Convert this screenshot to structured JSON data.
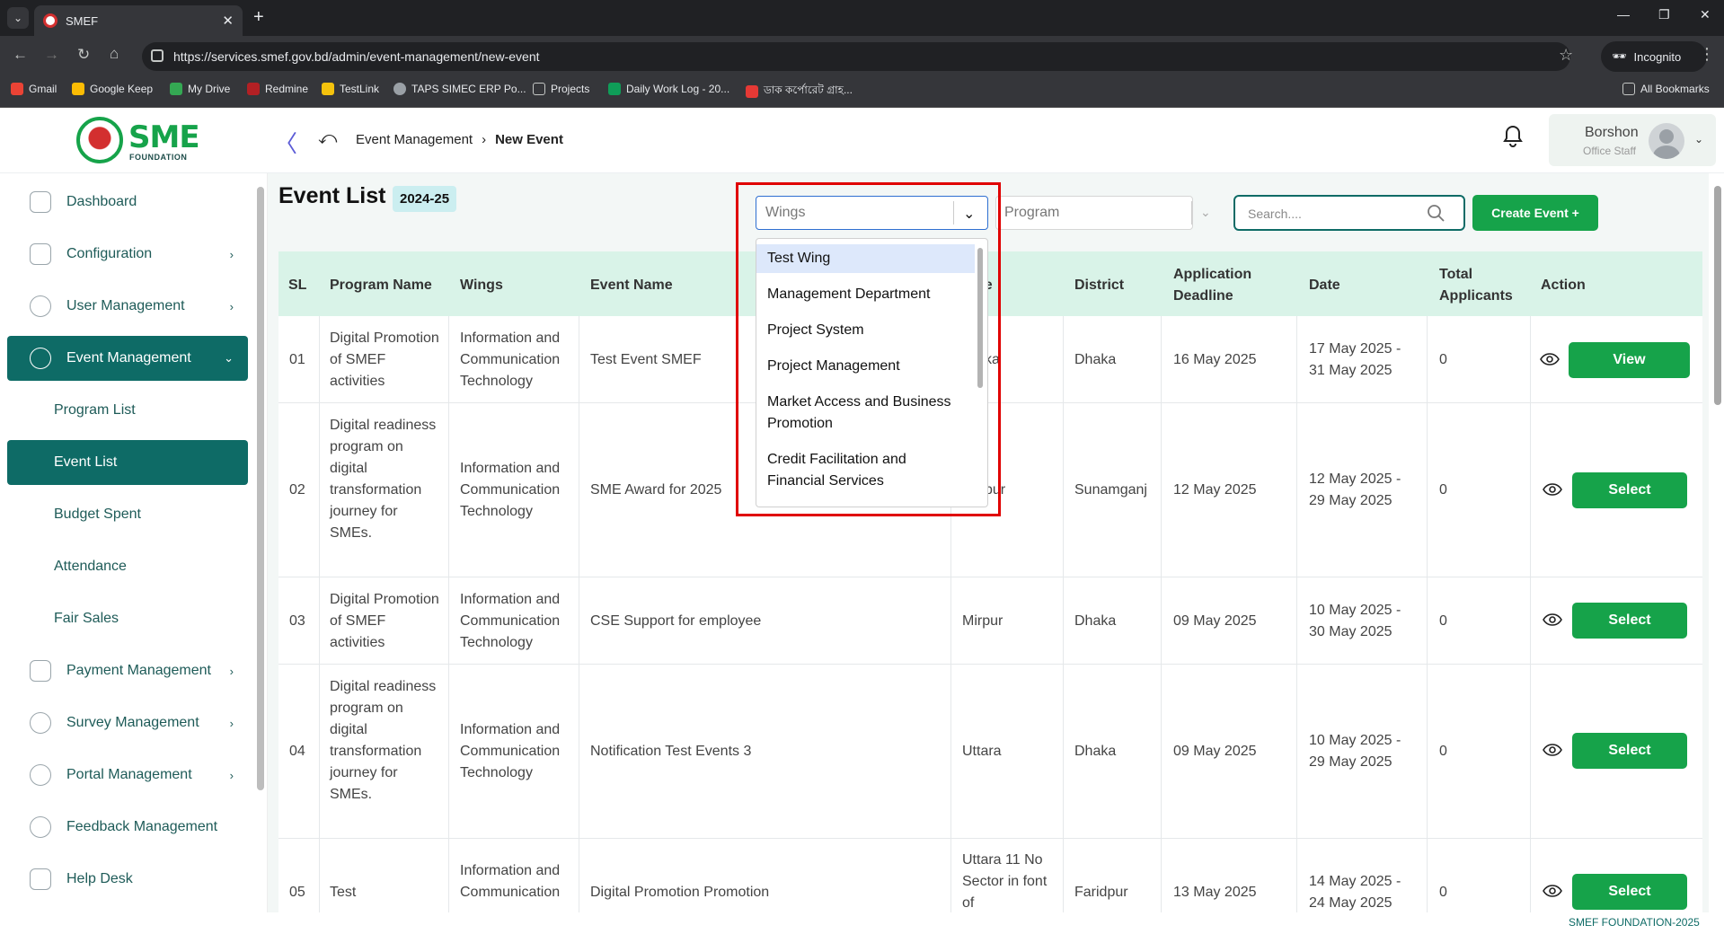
{
  "browser": {
    "tab_title": "SMEF",
    "url": "https://services.smef.gov.bd/admin/event-management/new-event",
    "incognito_label": "Incognito",
    "bookmarks": [
      "Gmail",
      "Google Keep",
      "My Drive",
      "Redmine",
      "TestLink",
      "TAPS SIMEC ERP Po...",
      "Projects",
      "Daily Work Log - 20...",
      "ডাক কর্পোরেট গ্রাহ...",
      "All Bookmarks"
    ]
  },
  "header": {
    "logo_text": "SME",
    "logo_sub": "FOUNDATION",
    "breadcrumb": [
      "Event Management",
      "New Event"
    ],
    "user_name": "Borshon",
    "user_role": "Office Staff"
  },
  "sidebar": {
    "items": [
      {
        "label": "Dashboard"
      },
      {
        "label": "Configuration"
      },
      {
        "label": "User Management"
      },
      {
        "label": "Event Management"
      },
      {
        "label": "Payment Management"
      },
      {
        "label": "Survey Management"
      },
      {
        "label": "Portal Management"
      },
      {
        "label": "Feedback Management"
      },
      {
        "label": "Help Desk"
      }
    ],
    "subitems": [
      {
        "label": "Program List"
      },
      {
        "label": "Event List"
      },
      {
        "label": "Budget Spent"
      },
      {
        "label": "Attendance"
      },
      {
        "label": "Fair Sales"
      }
    ]
  },
  "main": {
    "title": "Event List",
    "year": "2024-25",
    "wings_placeholder": "Wings",
    "program_placeholder": "Program",
    "search_placeholder": "Search....",
    "create_label": "Create Event +",
    "wings_options": [
      "Test Wing",
      "Management Department",
      "Project System",
      "Project Management",
      "Market Access and Business Promotion",
      "Credit Facilitation and Financial Services"
    ],
    "columns": [
      "SL",
      "Program Name",
      "Wings",
      "Event Name",
      "Venue",
      "District",
      "Application Deadline",
      "Date",
      "Total Applicants",
      "Action"
    ],
    "rows": [
      {
        "sl": "01",
        "program": "Digital Promotion of SMEF activities",
        "wings": "Information and Communication Technology",
        "event": "Test Event SMEF",
        "venue": "Dhaka",
        "district": "Dhaka",
        "deadline": "16 May 2025",
        "date": "17 May 2025 - 31 May 2025",
        "applicants": "0",
        "action": "View"
      },
      {
        "sl": "02",
        "program": "Digital readiness program on digital transformation journey for SMEs.",
        "wings": "Information and Communication Technology",
        "event": "SME Award for 2025",
        "venue": "Sylhet Sadar Jaintapur",
        "district": "Sunamganj",
        "deadline": "12 May 2025",
        "date": "12 May 2025 - 29 May 2025",
        "applicants": "0",
        "action": "Select"
      },
      {
        "sl": "03",
        "program": "Digital Promotion of SMEF activities",
        "wings": "Information and Communication Technology",
        "event": "CSE Support for employee",
        "venue": "Mirpur",
        "district": "Dhaka",
        "deadline": "09 May 2025",
        "date": "10 May 2025 - 30 May 2025",
        "applicants": "0",
        "action": "Select"
      },
      {
        "sl": "04",
        "program": "Digital readiness program on digital transformation journey for SMEs.",
        "wings": "Information and Communication Technology",
        "event": "Notification Test Events 3",
        "venue": "Uttara",
        "district": "Dhaka",
        "deadline": "09 May 2025",
        "date": "10 May 2025 - 29 May 2025",
        "applicants": "0",
        "action": "Select"
      },
      {
        "sl": "05",
        "program": "Test",
        "wings": "Information and Communication",
        "event": "Digital Promotion Promotion",
        "venue": "Uttara 11 No Sector in font of",
        "district": "Faridpur",
        "deadline": "13 May 2025",
        "date": "14 May 2025 - 24 May 2025",
        "applicants": "0",
        "action": "Select"
      }
    ],
    "visible_fragments": {
      "venue_header_tail": "ue",
      "row1_venue_tail": "ka",
      "row2_venue_tail": "pur"
    }
  },
  "footer": {
    "text": "SMEF FOUNDATION-2025"
  }
}
